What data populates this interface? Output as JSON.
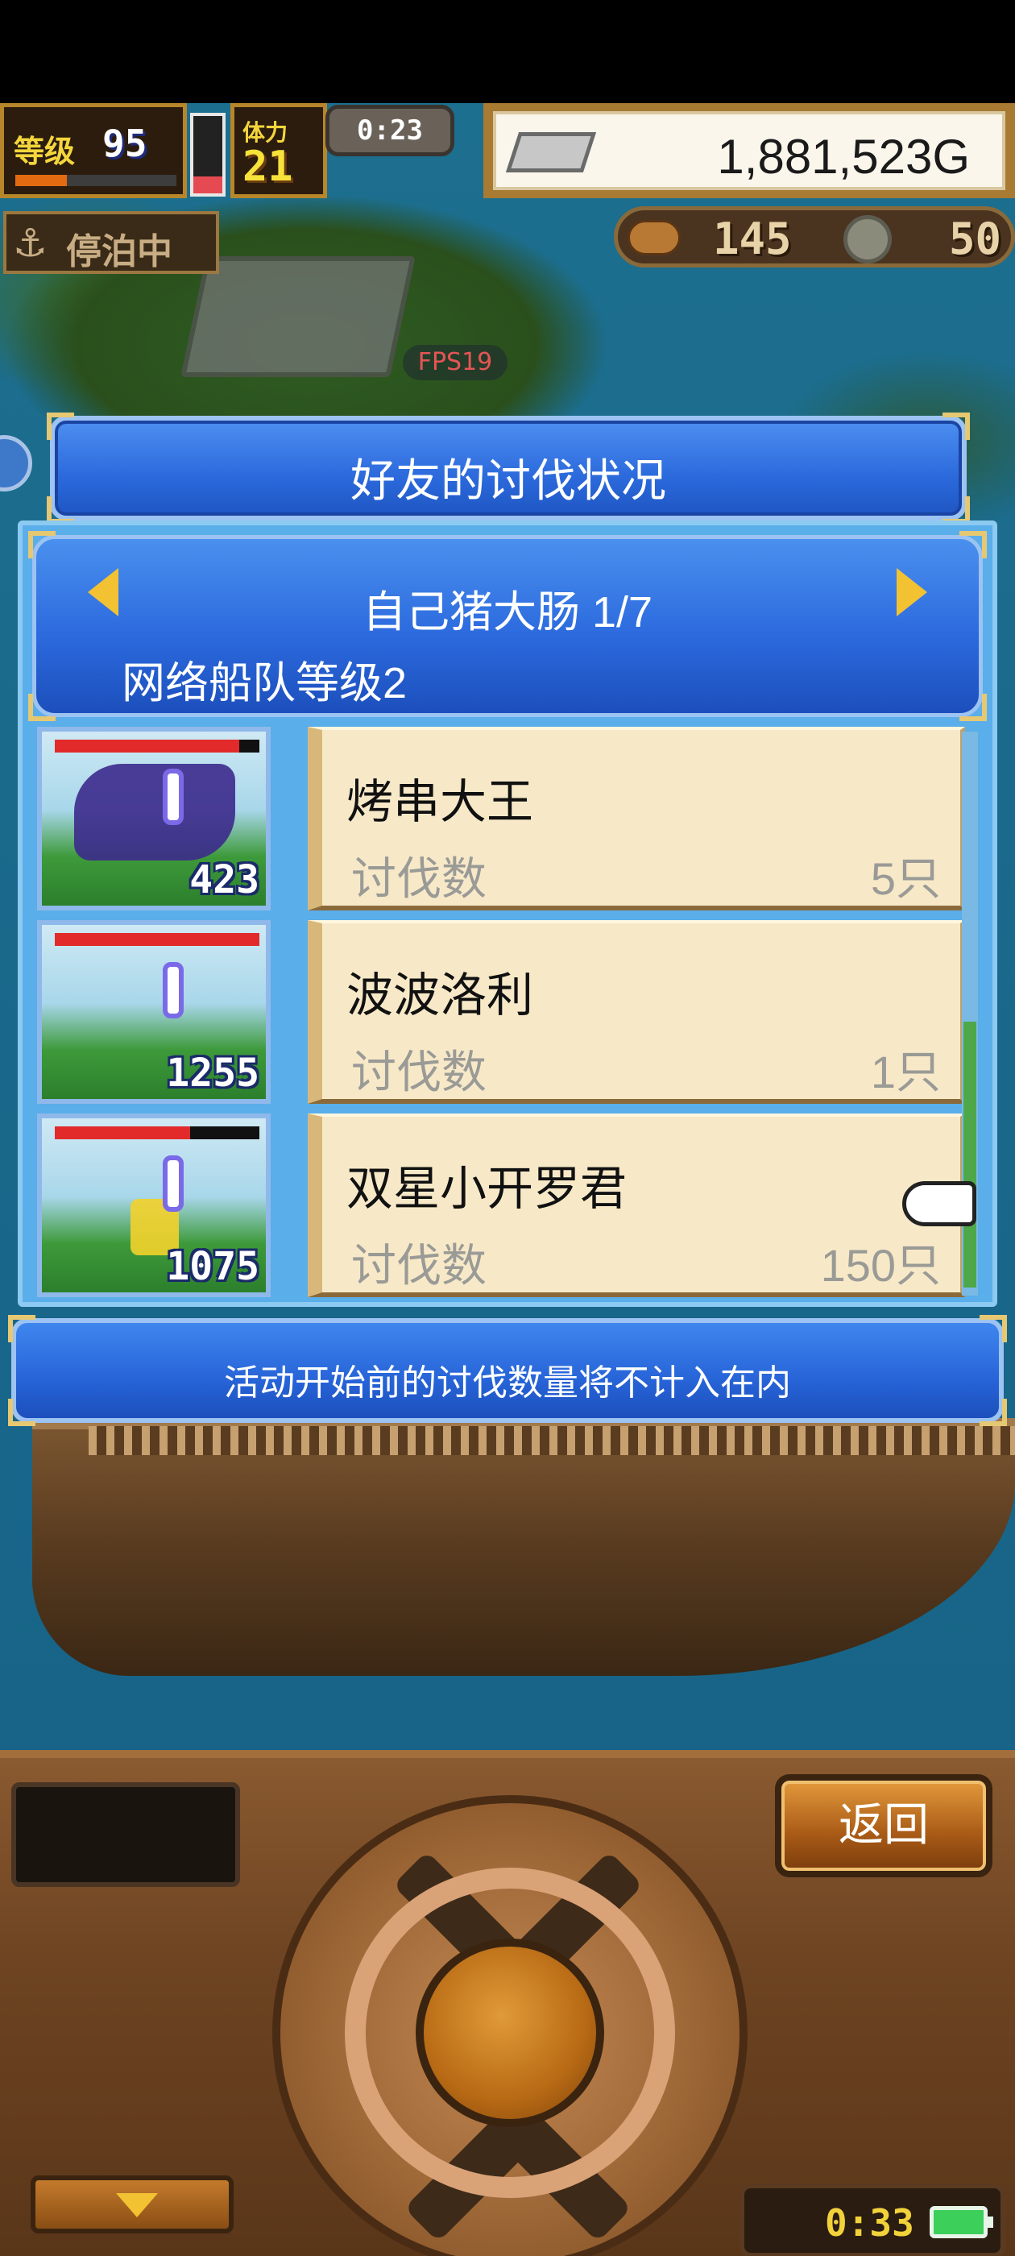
{
  "hud": {
    "level_label": "等级",
    "level_value": "95",
    "xp_fraction": 0.32,
    "hp_fraction": 0.22,
    "stamina_label": "体力",
    "stamina_value": "21",
    "timer": "0:23",
    "gold": "1,881,523G",
    "status": "停泊中",
    "resource_food": "145",
    "resource_coin": "50",
    "fps": "FPS19"
  },
  "dialog": {
    "title": "好友的讨伐状况",
    "player_name": "自己猪大肠 1/7",
    "fleet_level": "网络船队等级2",
    "rows": [
      {
        "name": "烤串大王",
        "stat_label": "讨伐数",
        "count": "5只",
        "power": "423",
        "hp_fraction": 0.9
      },
      {
        "name": "波波洛利",
        "stat_label": "讨伐数",
        "count": "1只",
        "power": "1255",
        "hp_fraction": 1.0
      },
      {
        "name": "双星小开罗君",
        "stat_label": "讨伐数",
        "count": "150只",
        "power": "1075",
        "hp_fraction": 0.66
      }
    ],
    "footer_note": "活动开始前的讨伐数量将不计入在内"
  },
  "controls": {
    "back_label": "返回",
    "clock": "0:33"
  },
  "colors": {
    "panel_blue": "#2b69dc",
    "card_bg": "#f7e9c8",
    "accent_gold": "#f2c233"
  }
}
